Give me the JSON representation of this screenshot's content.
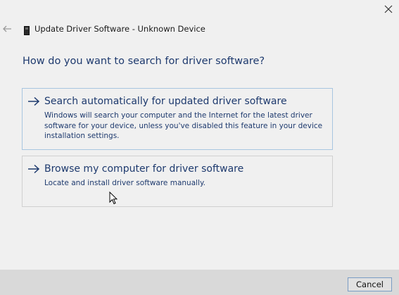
{
  "window": {
    "title": "Update Driver Software - Unknown Device",
    "close_icon": "close-icon",
    "back_icon": "back-arrow-icon",
    "device_icon": "device-icon"
  },
  "heading": "How do you want to search for driver software?",
  "options": [
    {
      "title": "Search automatically for updated driver software",
      "description": "Windows will search your computer and the Internet for the latest driver software for your device, unless you've disabled this feature in your device installation settings.",
      "icon": "arrow-right-icon"
    },
    {
      "title": "Browse my computer for driver software",
      "description": "Locate and install driver software manually.",
      "icon": "arrow-right-icon"
    }
  ],
  "footer": {
    "cancel_label": "Cancel"
  },
  "colors": {
    "accent_text": "#1e3a6e",
    "background": "#f0f0f0",
    "footer": "#d9d9d9",
    "button_border": "#7a9cc4"
  }
}
